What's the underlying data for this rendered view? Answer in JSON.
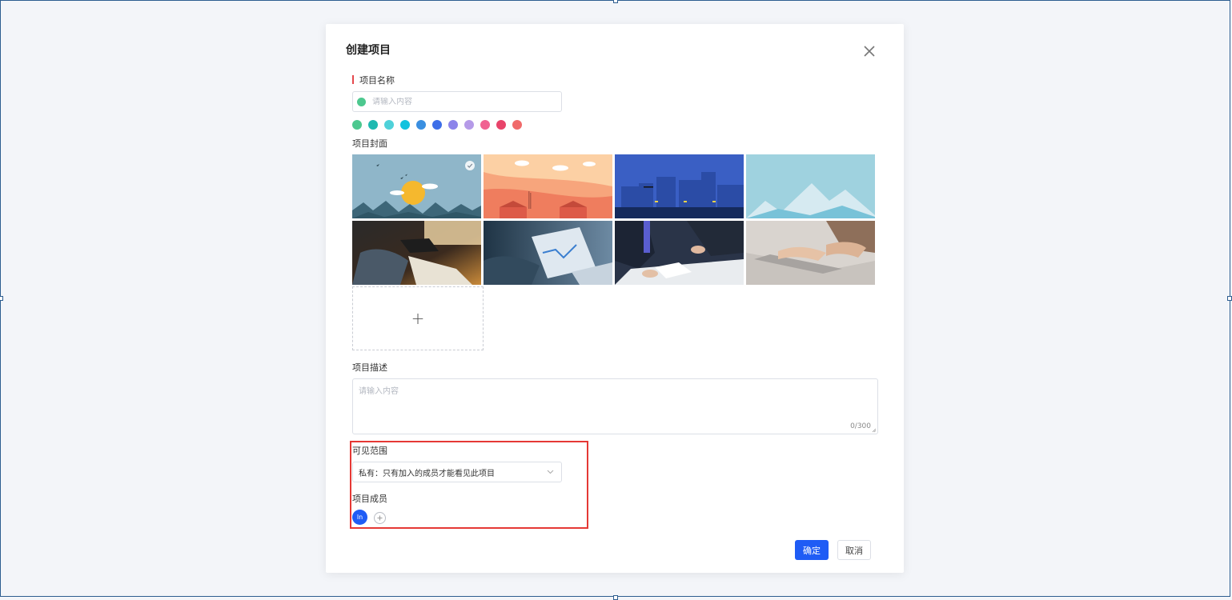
{
  "dialog": {
    "title": "创建项目",
    "name_label": "项目名称",
    "name_placeholder": "请输入内容",
    "name_color": "#4dc88f",
    "colors": [
      "#4dc88f",
      "#1fb9b0",
      "#4fd1d9",
      "#13c2de",
      "#3a8fe0",
      "#3d6ee8",
      "#8c84ea",
      "#b59ae8",
      "#f06292",
      "#e8446a",
      "#f06a6a"
    ],
    "cover_label": "项目封面",
    "covers": [
      {
        "name": "mountain-sun"
      },
      {
        "name": "sunset-village"
      },
      {
        "name": "night-city"
      },
      {
        "name": "snow-mountains"
      },
      {
        "name": "office-desk-photo"
      },
      {
        "name": "tablet-chart-photo"
      },
      {
        "name": "business-meeting-photo"
      },
      {
        "name": "laptop-typing-photo"
      }
    ],
    "selected_cover": 0,
    "upload_glyph": "+",
    "desc_label": "项目描述",
    "desc_placeholder": "请输入内容",
    "desc_count": "0/300",
    "visibility_label": "可见范围",
    "visibility_value": "私有：只有加入的成员才能看见此项目",
    "members_label": "项目成员",
    "member_avatar_text": "ln",
    "ok_label": "确定",
    "cancel_label": "取消",
    "accent_color": "#1f5cf5",
    "highlight_color": "#e53935"
  }
}
